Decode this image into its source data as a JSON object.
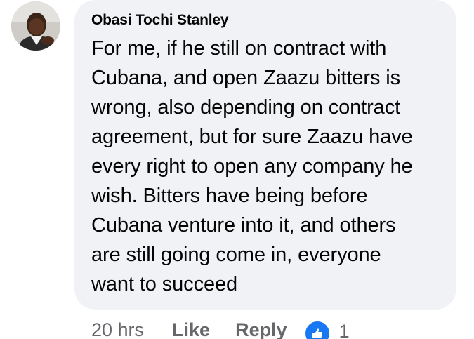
{
  "comment": {
    "author": "Obasi Tochi Stanley",
    "text": "For me, if he still on contract with\nCubana, and open Zaazu bitters is\nwrong, also depending on contract\nagreement, but for sure Zaazu have\nevery right to open any company he\nwish. Bitters have being before\nCubana venture into it, and others\nare still going come in, everyone\nwant to succeed",
    "timestamp": "20 hrs",
    "like_label": "Like",
    "reply_label": "Reply",
    "reaction_icon": "thumbs-up-icon",
    "reaction_count": "1"
  },
  "colors": {
    "bubble_bg": "#f0f2f5",
    "text": "#050505",
    "meta_text": "#65676b",
    "like_blue": "#1877f2"
  }
}
